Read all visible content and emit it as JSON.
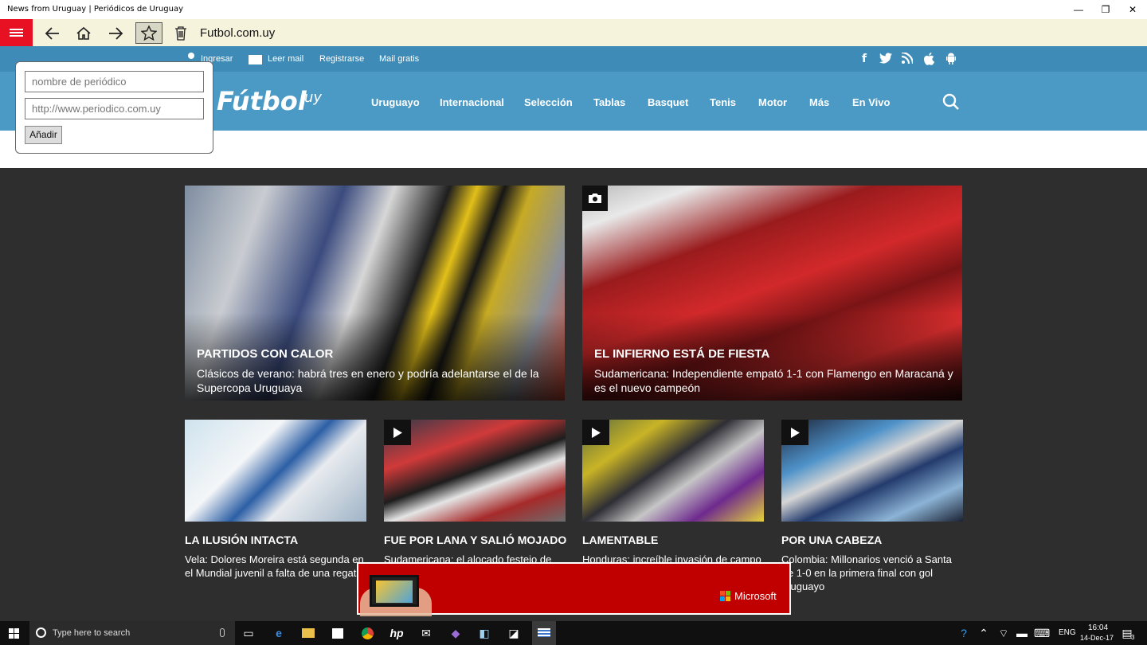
{
  "window": {
    "title": "News from Uruguay | Periódicos de Uruguay",
    "minimize": "—",
    "restore": "❐",
    "close": "✕"
  },
  "toolbar": {
    "url": "Futbol.com.uy"
  },
  "site": {
    "top_links": [
      "Ingresar",
      "Leer mail",
      "Registrarse",
      "Mail gratis"
    ],
    "logo": "Fútbol",
    "logo_suffix": "uy",
    "nav": [
      "Uruguayo",
      "Internacional",
      "Selección",
      "Tablas",
      "Basquet",
      "Tenis",
      "Motor",
      "Más",
      "En Vivo"
    ]
  },
  "popup": {
    "name_placeholder": "nombre de periódico",
    "url_placeholder": "http://www.periodico.com.uy",
    "add_label": "Añadir"
  },
  "featured": [
    {
      "headline": "PARTIDOS CON CALOR",
      "summary": "Clásicos de verano: habrá tres en enero y podría adelantarse el de la Supercopa Uruguaya"
    },
    {
      "headline": "EL INFIERNO ESTÁ DE FIESTA",
      "summary": "Sudamericana: Independiente empató 1-1 con Flamengo en Maracaná y es el nuevo campeón"
    }
  ],
  "articles": [
    {
      "headline": "LA ILUSIÓN INTACTA",
      "summary": "Vela: Dolores Moreira está segunda en el Mundial juvenil a falta de una regata"
    },
    {
      "headline": "FUE POR LANA Y SALIÓ MOJADO",
      "summary": "Sudamericana: el alocado festejo de"
    },
    {
      "headline": "LAMENTABLE",
      "summary": "Honduras: increíble invasión de campo"
    },
    {
      "headline": "POR UNA CABEZA",
      "summary": "Colombia: Millonarios venció a Santa Fe 1-0 en la primera final con gol uruguayo"
    }
  ],
  "ad": {
    "brand": "Microsoft"
  },
  "taskbar": {
    "search_placeholder": "Type here to search",
    "lang": "ENG",
    "time": "16:04",
    "date": "14-Dec-17",
    "notifications": "3"
  },
  "colors": {
    "accent_red": "#e81123",
    "site_blue": "#4b9ac6",
    "site_blue_dark": "#3d8bb6",
    "toolbar_bg": "#f5f3dc",
    "content_bg": "#2e2e2e",
    "ad_red": "#c00000"
  }
}
